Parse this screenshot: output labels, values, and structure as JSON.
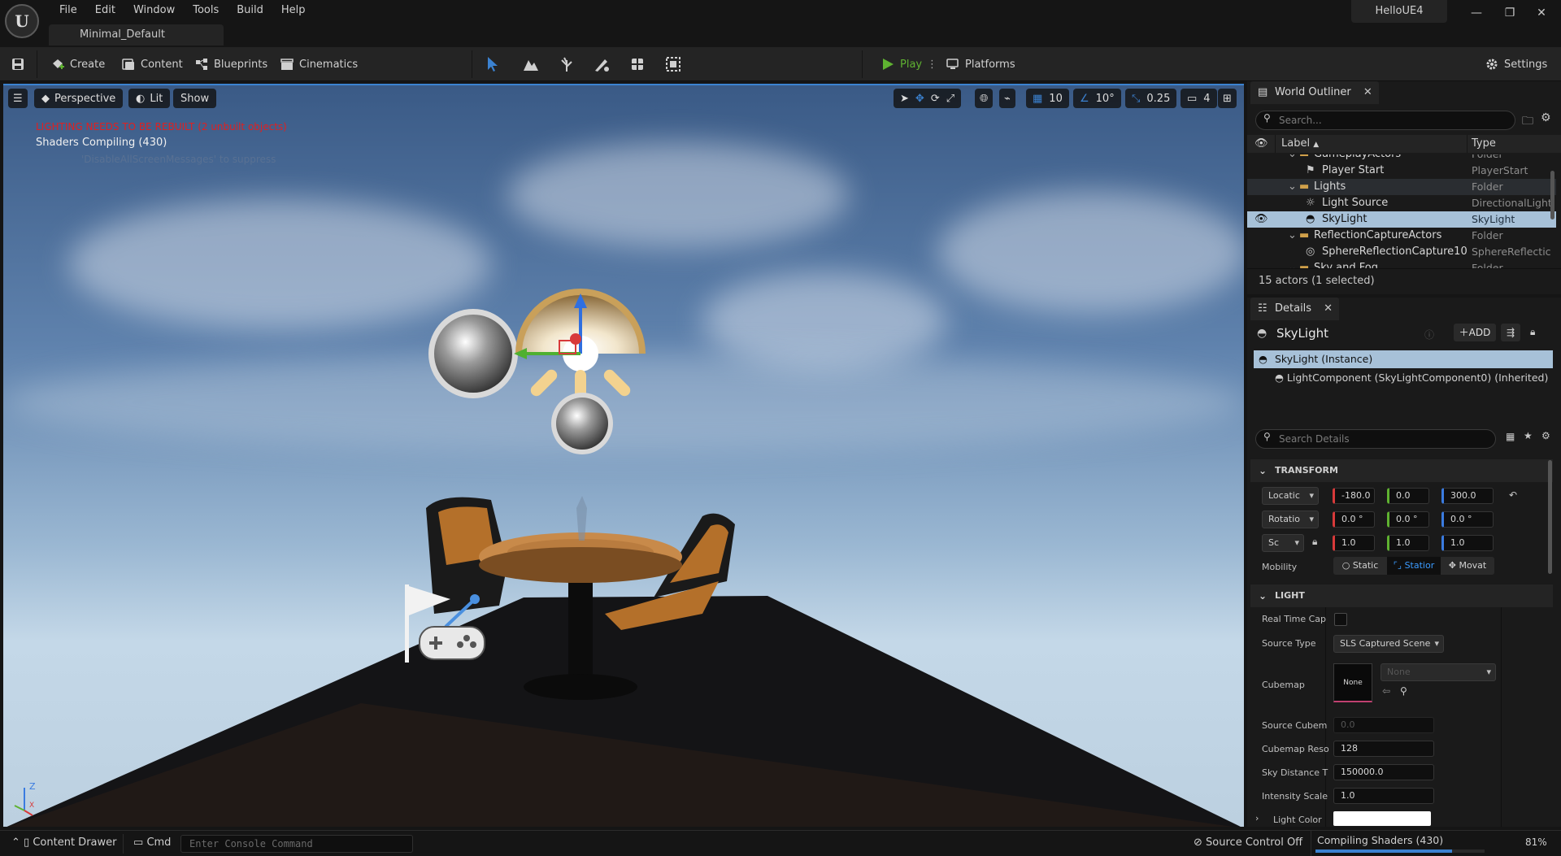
{
  "window": {
    "project_tab": "Minimal_Default",
    "project_name": "HelloUE4",
    "menu": [
      "File",
      "Edit",
      "Window",
      "Tools",
      "Build",
      "Help"
    ]
  },
  "toolbar": {
    "create": "Create",
    "content": "Content",
    "blueprints": "Blueprints",
    "cinematics": "Cinematics",
    "play": "Play",
    "platforms": "Platforms",
    "settings": "Settings"
  },
  "viewport": {
    "perspective": "Perspective",
    "lit": "Lit",
    "show": "Show",
    "grid_snap": "10",
    "rotation_snap": "10°",
    "scale_snap": "0.25",
    "camera_speed": "4",
    "lighting_warning": "LIGHTING NEEDS TO BE REBUILT (2 unbuilt objects)",
    "shaders_compiling": "Shaders Compiling (430)",
    "ghost_text": "'DisableAllScreenMessages' to suppress"
  },
  "outliner": {
    "title": "World Outliner",
    "search_placeholder": "Search...",
    "col_label": "Label",
    "col_type": "Type",
    "rows": [
      {
        "label": "GameplayActors",
        "type": "Folder"
      },
      {
        "label": "Player Start",
        "type": "PlayerStart"
      },
      {
        "label": "Lights",
        "type": "Folder"
      },
      {
        "label": "Light Source",
        "type": "DirectionalLight"
      },
      {
        "label": "SkyLight",
        "type": "SkyLight"
      },
      {
        "label": "ReflectionCaptureActors",
        "type": "Folder"
      },
      {
        "label": "SphereReflectionCapture10",
        "type": "SphereReflectic"
      },
      {
        "label": "Sky and Fog",
        "type": "Folder"
      }
    ],
    "count": "15 actors (1 selected)"
  },
  "details": {
    "title": "Details",
    "actor_name": "SkyLight",
    "add_label": "ADD",
    "instance": "SkyLight (Instance)",
    "component": "LightComponent (SkyLightComponent0) (Inherited)",
    "search_placeholder": "Search Details",
    "transform": {
      "header": "TRANSFORM",
      "location_label": "Locatic",
      "rotation_label": "Rotatio",
      "scale_label": "Sc",
      "location": [
        "-180.0",
        "0.0",
        "300.0"
      ],
      "rotation": [
        "0.0 °",
        "0.0 °",
        "0.0 °"
      ],
      "scale": [
        "1.0",
        "1.0",
        "1.0"
      ],
      "mobility_label": "Mobility",
      "mobility_options": [
        "Static",
        "Statior",
        "Movat"
      ],
      "mobility_selected": "Statior"
    },
    "light": {
      "header": "LIGHT",
      "real_time_capture": "Real Time Cap",
      "source_type_label": "Source Type",
      "source_type_value": "SLS Captured Scene",
      "cubemap_label": "Cubemap",
      "cubemap_thumb": "None",
      "cubemap_asset": "None",
      "source_cubemap_label": "Source Cubem",
      "source_cubemap_value": "0.0",
      "cubemap_res_label": "Cubemap Reso",
      "cubemap_res_value": "128",
      "sky_distance_label": "Sky Distance T",
      "sky_distance_value": "150000.0",
      "intensity_label": "Intensity Scale",
      "intensity_value": "1.0",
      "light_color_label": "Light Color"
    }
  },
  "statusbar": {
    "content_drawer": "Content Drawer",
    "cmd": "Cmd",
    "console_placeholder": "Enter Console Command",
    "source_control": "Source Control Off",
    "compiling": "Compiling Shaders (430)",
    "progress_percent": "81%",
    "progress_fraction": 0.81
  },
  "colors": {
    "accent_blue": "#3b82d1",
    "play_green": "#5fb231",
    "warning_red": "#e02020",
    "selection": "#a7c1d8"
  }
}
